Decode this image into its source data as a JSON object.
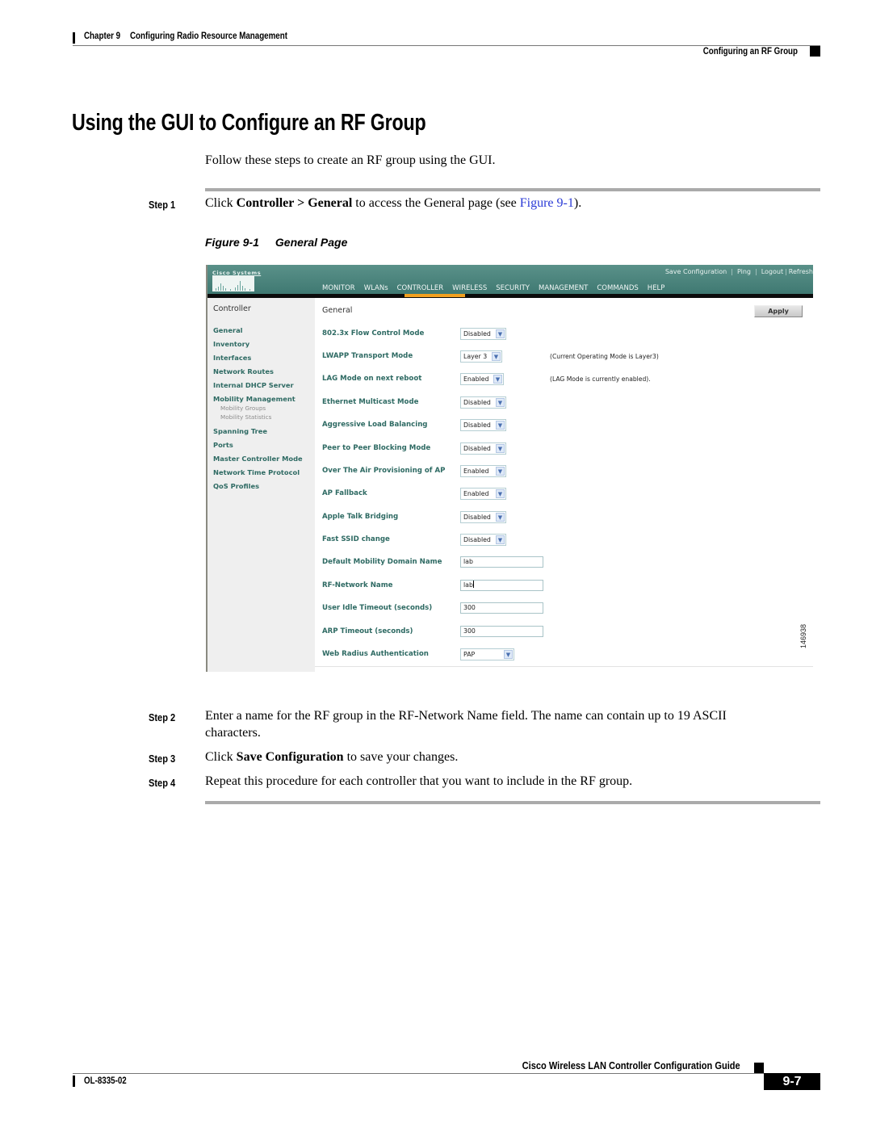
{
  "header": {
    "chapter": "Chapter 9",
    "chapter_title": "Configuring Radio Resource Management",
    "section": "Configuring an RF Group"
  },
  "title": "Using the GUI to Configure an RF Group",
  "intro": "Follow these steps to create an RF group using the GUI.",
  "steps": [
    {
      "label": "Step 1",
      "parts": [
        "Click ",
        "Controller",
        " > ",
        "General",
        " to access the General page (see ",
        "Figure 9-1",
        ")."
      ]
    },
    {
      "label": "Step 2",
      "line1": "Enter a name for the RF group in the RF-Network Name field. The name can contain up to 19 ASCII",
      "line2": "characters."
    },
    {
      "label": "Step 3",
      "parts": [
        "Click ",
        "Save Configuration",
        " to save your changes."
      ]
    },
    {
      "label": "Step 4",
      "text": "Repeat this procedure for each controller that you want to include in the RF group."
    }
  ],
  "figure": {
    "number": "Figure 9-1",
    "caption": "General Page",
    "figure_id": "146938",
    "app": {
      "logo_text": "Cisco Systems",
      "top_links": [
        "Save Configuration",
        "Ping",
        "Logout",
        "Refresh"
      ],
      "nav": [
        "MONITOR",
        "WLANs",
        "CONTROLLER",
        "WIRELESS",
        "SECURITY",
        "MANAGEMENT",
        "COMMANDS",
        "HELP"
      ],
      "active_nav": "CONTROLLER",
      "accent_color": "#f2a01f",
      "sidebar": {
        "title": "Controller",
        "items": [
          "General",
          "Inventory",
          "Interfaces",
          "Network Routes",
          "Internal DHCP Server",
          "Mobility Management",
          "Spanning Tree",
          "Ports",
          "Master Controller Mode",
          "Network Time Protocol",
          "QoS Profiles"
        ],
        "subitems": [
          "Mobility Groups",
          "Mobility Statistics"
        ]
      },
      "page_title": "General",
      "apply_label": "Apply",
      "settings": [
        {
          "label": "802.3x Flow Control Mode",
          "type": "select",
          "value": "Disabled"
        },
        {
          "label": "LWAPP Transport Mode",
          "type": "select",
          "value": "Layer 3",
          "note": "(Current Operating Mode is Layer3)"
        },
        {
          "label": "LAG Mode on next reboot",
          "type": "select",
          "value": "Enabled",
          "note": "(LAG Mode is currently enabled)."
        },
        {
          "label": "Ethernet Multicast Mode",
          "type": "select",
          "value": "Disabled"
        },
        {
          "label": "Aggressive Load Balancing",
          "type": "select",
          "value": "Disabled"
        },
        {
          "label": "Peer to Peer Blocking Mode",
          "type": "select",
          "value": "Disabled"
        },
        {
          "label": "Over The Air Provisioning of AP",
          "type": "select",
          "value": "Enabled"
        },
        {
          "label": "AP Fallback",
          "type": "select",
          "value": "Enabled"
        },
        {
          "label": "Apple Talk Bridging",
          "type": "select",
          "value": "Disabled"
        },
        {
          "label": "Fast SSID change",
          "type": "select",
          "value": "Disabled"
        },
        {
          "label": "Default Mobility Domain Name",
          "type": "text",
          "value": "lab"
        },
        {
          "label": "RF-Network Name",
          "type": "text",
          "value": "lab"
        },
        {
          "label": "User Idle Timeout (seconds)",
          "type": "text",
          "value": "300"
        },
        {
          "label": "ARP Timeout (seconds)",
          "type": "text",
          "value": "300"
        },
        {
          "label": "Web Radius Authentication",
          "type": "select",
          "value": "PAP"
        }
      ]
    }
  },
  "footer": {
    "guide_title": "Cisco Wireless LAN Controller Configuration Guide",
    "page_number": "9-7",
    "doc_number": "OL-8335-02"
  }
}
